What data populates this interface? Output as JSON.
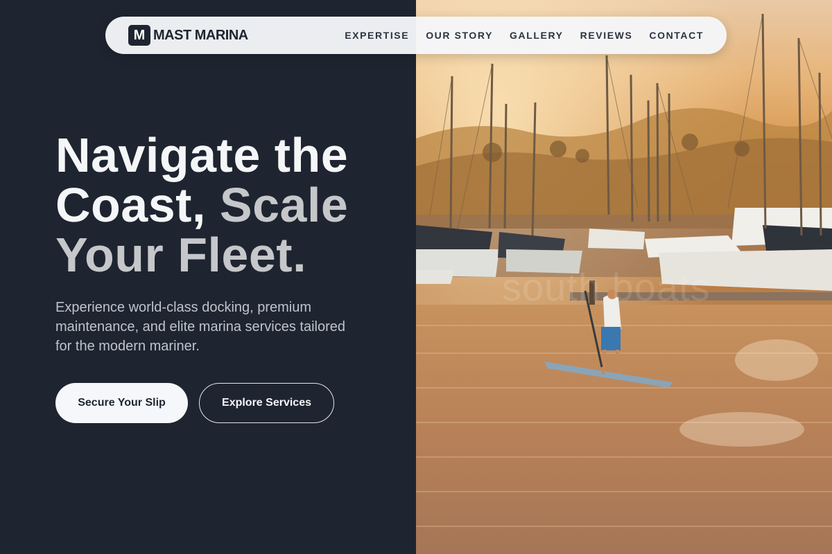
{
  "brand": {
    "mark": "M",
    "name": "MAST MARINA"
  },
  "nav": {
    "links": [
      "EXPERTISE",
      "OUR STORY",
      "GALLERY",
      "REVIEWS",
      "CONTACT"
    ]
  },
  "hero": {
    "title": {
      "line1": "Navigate the",
      "line2_white": "Coast,",
      "line2_gray": "Scale",
      "line3": "Your Fleet."
    },
    "description": "Experience world-class docking, premium maintenance, and elite marina services tailored for the modern mariner.",
    "primary_cta": "Secure Your Slip",
    "secondary_cta": "Explore Services"
  },
  "image": {
    "watermark": "south boats"
  },
  "colors": {
    "dark_bg": "#1e2530",
    "nav_bg": "#f5f6f8",
    "accent_gray": "#c5c7ca"
  }
}
